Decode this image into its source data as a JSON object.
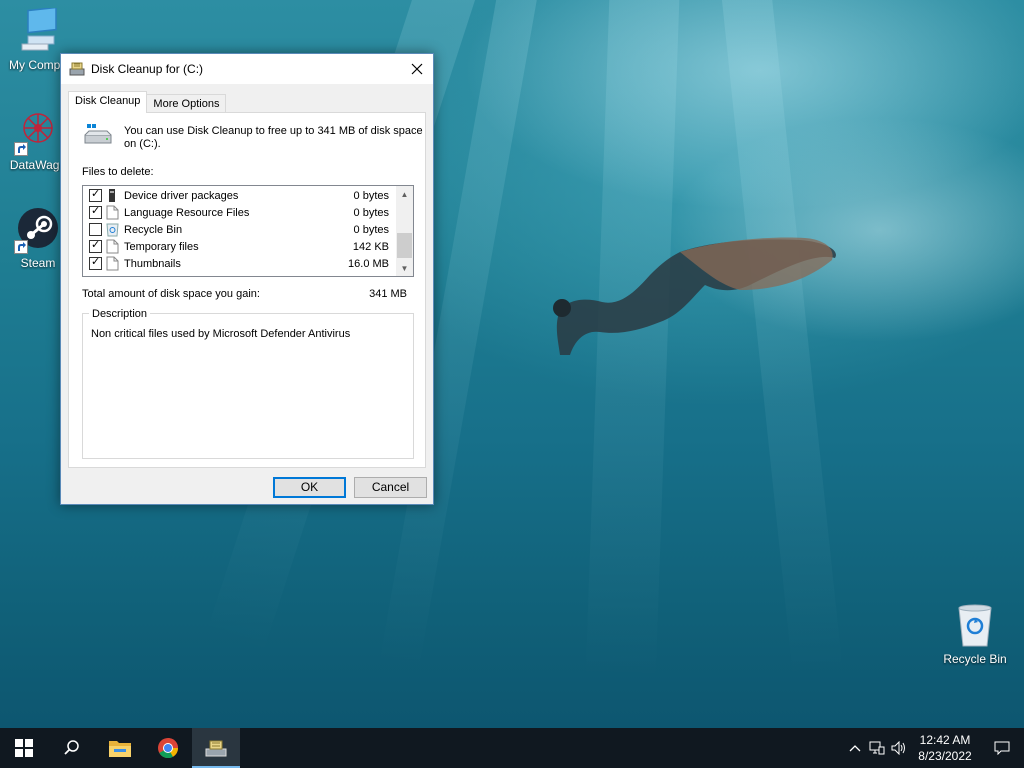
{
  "desktop": {
    "icons": [
      {
        "label": "My Compu",
        "icon": "computer-icon"
      },
      {
        "label": "DataWago",
        "icon": "datawagon-icon"
      },
      {
        "label": "Steam",
        "icon": "steam-icon"
      },
      {
        "label": "Recycle Bin",
        "icon": "recycle-bin-icon"
      }
    ]
  },
  "dialog": {
    "title": "Disk Cleanup for  (C:)",
    "tabs": [
      {
        "label": "Disk Cleanup",
        "active": true
      },
      {
        "label": "More Options",
        "active": false
      }
    ],
    "intro": "You can use Disk Cleanup to free up to 341 MB of disk space on  (C:).",
    "files_label": "Files to delete:",
    "files": [
      {
        "name": "Device driver packages",
        "size": "0 bytes",
        "checked": true,
        "icon": "driver-icon"
      },
      {
        "name": "Language Resource Files",
        "size": "0 bytes",
        "checked": true,
        "icon": "file-icon"
      },
      {
        "name": "Recycle Bin",
        "size": "0 bytes",
        "checked": false,
        "icon": "recycle-bin-icon"
      },
      {
        "name": "Temporary files",
        "size": "142 KB",
        "checked": true,
        "icon": "file-icon"
      },
      {
        "name": "Thumbnails",
        "size": "16.0 MB",
        "checked": true,
        "icon": "file-icon"
      }
    ],
    "total_label": "Total amount of disk space you gain:",
    "total_value": "341 MB",
    "description_label": "Description",
    "description_text": "Non critical files used by Microsoft Defender Antivirus",
    "ok_label": "OK",
    "cancel_label": "Cancel"
  },
  "taskbar": {
    "items": [
      "start-icon",
      "search-icon",
      "file-explorer-icon",
      "chrome-icon",
      "disk-cleanup-icon"
    ],
    "active_item": "disk-cleanup-icon",
    "time": "12:42 AM",
    "date": "8/23/2022"
  },
  "colors": {
    "accent": "#0078d7",
    "taskbar": "#101820",
    "wallpaper": "#1f7e93"
  }
}
